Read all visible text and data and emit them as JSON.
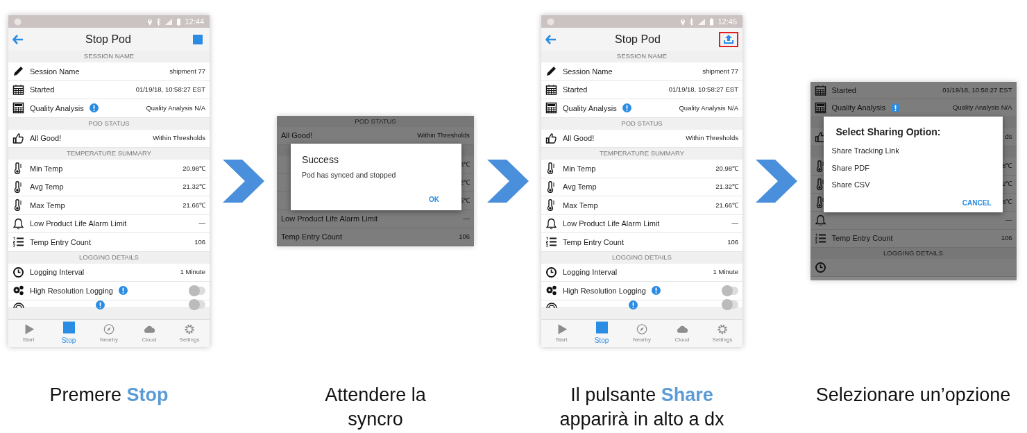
{
  "steps": [
    {
      "kind": "phone",
      "screen": {
        "status_time": "12:44",
        "title": "Stop Pod",
        "action": {
          "kind": "stop",
          "highlighted": false
        },
        "rows": [
          {
            "kind": "header",
            "text": "SESSION NAME"
          },
          {
            "kind": "item",
            "label": "Session Name",
            "value": "shipment 77"
          },
          {
            "kind": "item",
            "label": "Started",
            "value": "01/19/18, 10:58:27 EST"
          },
          {
            "kind": "item",
            "label": "Quality Analysis",
            "info": true,
            "value": "Quality Analysis N/A"
          },
          {
            "kind": "header",
            "text": "POD STATUS"
          },
          {
            "kind": "item",
            "label": "All Good!",
            "value": "Within Thresholds"
          },
          {
            "kind": "header",
            "text": "TEMPERATURE SUMMARY"
          },
          {
            "kind": "item",
            "label": "Min Temp",
            "value": "20.98℃"
          },
          {
            "kind": "item",
            "label": "Avg Temp",
            "value": "21.32℃"
          },
          {
            "kind": "item",
            "label": "Max Temp",
            "value": "21.66℃"
          },
          {
            "kind": "item",
            "label": "Low Product Life Alarm Limit",
            "value": "—"
          },
          {
            "kind": "item",
            "label": "Temp Entry Count",
            "value": "106"
          },
          {
            "kind": "header",
            "text": "LOGGING DETAILS"
          },
          {
            "kind": "item",
            "label": "Logging Interval",
            "value": "1 Minute"
          },
          {
            "kind": "toggle",
            "label": "High Resolution Logging",
            "info": true,
            "on": false
          },
          {
            "kind": "partial",
            "info": true,
            "on": false
          }
        ],
        "tabs": [
          {
            "label": "Start",
            "selected": false
          },
          {
            "label": "Stop",
            "selected": true
          },
          {
            "label": "Nearby",
            "selected": false
          },
          {
            "label": "Cloud",
            "selected": false
          },
          {
            "label": "Settings",
            "selected": false
          }
        ]
      },
      "caption": "Premere **Stop**"
    },
    {
      "kind": "crop",
      "rows": [
        {
          "kind": "header",
          "text": "POD STATUS"
        },
        {
          "kind": "item",
          "label": "All Good!",
          "value": "Within Thresholds"
        },
        {
          "kind": "header"
        },
        {
          "kind": "item",
          "value": "8℃"
        },
        {
          "kind": "item",
          "value": "2℃"
        },
        {
          "kind": "item",
          "value": "6℃"
        },
        {
          "kind": "item",
          "label": "Low Product Life Alarm Limit",
          "value": "—"
        },
        {
          "kind": "item",
          "label": "Temp Entry Count",
          "value": "106"
        }
      ],
      "dialog": {
        "title": "Success",
        "message": "Pod has synced and stopped",
        "buttons": [
          "OK"
        ]
      },
      "caption": "Attendere la syncro"
    },
    {
      "kind": "phone",
      "screen": {
        "status_time": "12:45",
        "title": "Stop Pod",
        "action": {
          "kind": "share",
          "highlighted": true
        },
        "rows": [
          {
            "kind": "header",
            "text": "SESSION NAME"
          },
          {
            "kind": "item",
            "label": "Session Name",
            "value": "shipment 77"
          },
          {
            "kind": "item",
            "label": "Started",
            "value": "01/19/18, 10:58:27 EST"
          },
          {
            "kind": "item",
            "label": "Quality Analysis",
            "info": true,
            "value": "Quality Analysis N/A"
          },
          {
            "kind": "header",
            "text": "POD STATUS"
          },
          {
            "kind": "item",
            "label": "All Good!",
            "value": "Within Thresholds"
          },
          {
            "kind": "header",
            "text": "TEMPERATURE SUMMARY"
          },
          {
            "kind": "item",
            "label": "Min Temp",
            "value": "20.98℃"
          },
          {
            "kind": "item",
            "label": "Avg Temp",
            "value": "21.32℃"
          },
          {
            "kind": "item",
            "label": "Max Temp",
            "value": "21.66℃"
          },
          {
            "kind": "item",
            "label": "Low Product Life Alarm Limit",
            "value": "—"
          },
          {
            "kind": "item",
            "label": "Temp Entry Count",
            "value": "106"
          },
          {
            "kind": "header",
            "text": "LOGGING DETAILS"
          },
          {
            "kind": "item",
            "label": "Logging Interval",
            "value": "1 Minute"
          },
          {
            "kind": "toggle",
            "label": "High Resolution Logging",
            "info": true,
            "on": false
          },
          {
            "kind": "partial",
            "info": true,
            "on": false
          }
        ],
        "tabs": [
          {
            "label": "Start",
            "selected": false
          },
          {
            "label": "Stop",
            "selected": true
          },
          {
            "label": "Nearby",
            "selected": false
          },
          {
            "label": "Cloud",
            "selected": false
          },
          {
            "label": "Settings",
            "selected": false
          }
        ]
      },
      "caption": "Il pulsante **Share** apparirà in alto a dx"
    },
    {
      "kind": "crop",
      "rows": [
        {
          "kind": "item",
          "label": "Started",
          "value": "01/19/18, 10:58:27 EST"
        },
        {
          "kind": "item",
          "label": "Quality Analysis",
          "info": true,
          "value": "Quality Analysis N/A"
        },
        {
          "kind": "header"
        },
        {
          "kind": "item",
          "value": "ds"
        },
        {
          "kind": "header"
        },
        {
          "kind": "item",
          "value": "8℃"
        },
        {
          "kind": "item",
          "value": "2℃"
        },
        {
          "kind": "item",
          "value": "6℃"
        },
        {
          "kind": "item",
          "value": "—"
        },
        {
          "kind": "item",
          "label": "Temp Entry Count",
          "value": "106"
        },
        {
          "kind": "header",
          "text": "LOGGING DETAILS"
        },
        {
          "kind": "item"
        }
      ],
      "dialog": {
        "title": "Select Sharing Option:",
        "options": [
          "Share Tracking Link",
          "Share PDF",
          "Share CSV"
        ],
        "buttons": [
          "CANCEL"
        ]
      },
      "caption": "Selezionare un’opzione"
    }
  ]
}
